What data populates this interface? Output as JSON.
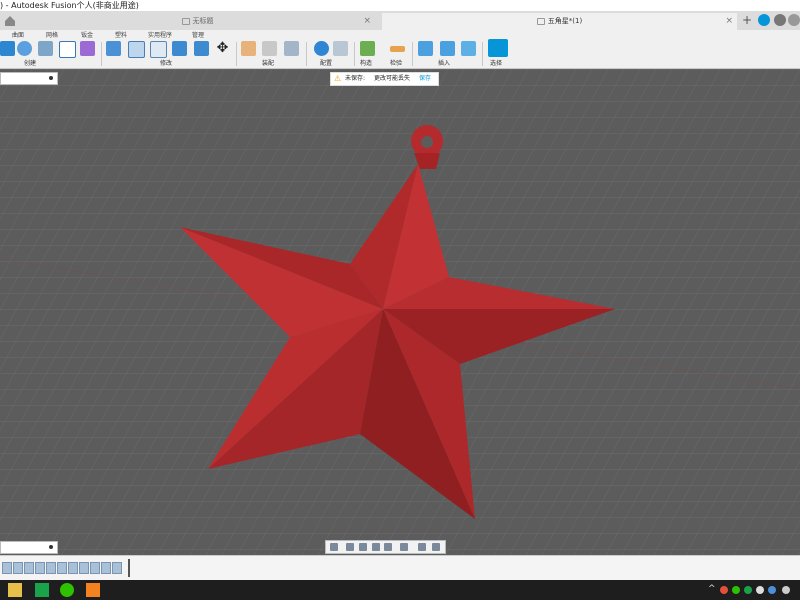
{
  "window": {
    "title": ") - Autodesk Fusion个人(非商业用途)"
  },
  "tabs": [
    {
      "label": "无标题",
      "active": false
    },
    {
      "label": "五角星*(1)",
      "active": true
    }
  ],
  "ribbon": {
    "tab_labels": [
      "曲面",
      "网格",
      "钣金",
      "塑料",
      "实用程序",
      "管理"
    ],
    "groups": {
      "create": "创建",
      "modify": "修改",
      "assemble": "装配",
      "configure": "配置",
      "construct": "构造",
      "inspect": "检验",
      "insert": "插入",
      "select": "选择"
    }
  },
  "notice": {
    "title": "未保存:",
    "message": "更改可能丢失",
    "action": "保存"
  },
  "model": {
    "name": "five-pointed star ornament",
    "color": "#b52a2c"
  },
  "colors": {
    "viewport_bg": "#5f5f5f",
    "grid": "#7a7a7a",
    "accent": "#0696d7"
  }
}
